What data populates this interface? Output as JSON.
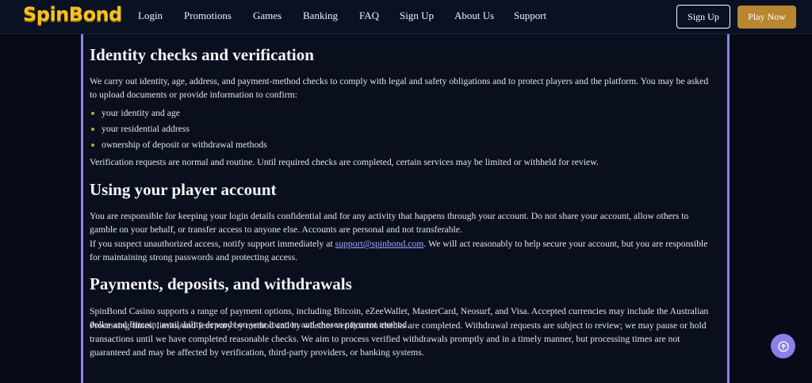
{
  "header": {
    "logo": "SpinBond",
    "nav": [
      "Login",
      "Promotions",
      "Games",
      "Banking",
      "FAQ",
      "Sign Up",
      "About Us",
      "Support"
    ],
    "signup_label": "Sign Up",
    "play_label": "Play Now"
  },
  "sections": {
    "identity": {
      "title": "Identity checks and verification",
      "intro": "We carry out identity, age, address, and payment-method checks to comply with legal and safety obligations and to protect players and the platform. You may be asked to upload documents or provide information to confirm:",
      "bullets": [
        "your identity and age",
        "your residential address",
        "ownership of deposit or withdrawal methods"
      ],
      "outro": "Verification requests are normal and routine. Until required checks are completed, certain services may be limited or withheld for review."
    },
    "account": {
      "title": "Using your player account",
      "p1": "You are responsible for keeping your login details confidential and for any activity that happens through your account. Do not share your account, allow others to gamble on your behalf, or transfer access to anyone else. Accounts are personal and not transferable.",
      "p2_before": "If you suspect unauthorized access, notify support immediately at ",
      "p2_link": "support@spinbond.com",
      "p2_after": ". We will act reasonably to help secure your account, but you are responsible for maintaining strong passwords and protecting access."
    },
    "payments": {
      "title": "Payments, deposits, and withdrawals",
      "p1": "SpinBond Casino supports a range of payment options, including Bitcoin, eZeeWallet, MasterCard, Neosurf, and Visa. Accepted currencies may include the Australian dollar and Bitcoin; availability depends on your location and chosen payment method.",
      "p2": "Processing times, limits, and fees vary by method and by whether verification checks are completed. Withdrawal requests are subject to review; we may pause or hold transactions until we have completed reasonable checks. We aim to process verified withdrawals promptly and in a timely manner, but processing times are not guaranteed and may be affected by verification, third-party providers, or banking systems."
    }
  },
  "icons": {
    "fab": "arrow-up-circle-icon"
  },
  "colors": {
    "accent": "#8d84e8",
    "brand": "#f6c21e",
    "play_button": "#b8862e"
  }
}
